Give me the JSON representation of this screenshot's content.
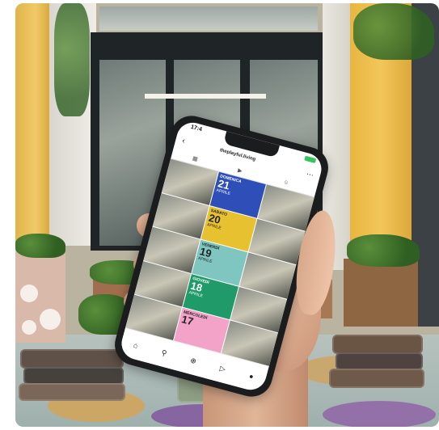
{
  "phone": {
    "status_time": "17:4",
    "username": "theplayful.living",
    "back_icon": "chevron-left-icon",
    "menu_icon": "more-icon",
    "tabs": [
      "grid-icon",
      "reels-icon",
      "tagged-icon"
    ],
    "nav_icons": [
      "home-icon",
      "search-icon",
      "add-icon",
      "reels-icon",
      "profile-icon"
    ],
    "posts": [
      {
        "kind": "photo"
      },
      {
        "kind": "day",
        "name": "DOMENICA",
        "num": "21",
        "mon": "APRILE",
        "color": "#2f4fb8"
      },
      {
        "kind": "photo"
      },
      {
        "kind": "photo"
      },
      {
        "kind": "day",
        "name": "SABATO",
        "num": "20",
        "mon": "APRILE",
        "color": "#e8c131",
        "dark": true
      },
      {
        "kind": "photo"
      },
      {
        "kind": "photo"
      },
      {
        "kind": "day",
        "name": "VENERDÌ",
        "num": "19",
        "mon": "APRILE",
        "color": "#7fc6c0",
        "dark": true
      },
      {
        "kind": "photo"
      },
      {
        "kind": "photo"
      },
      {
        "kind": "day",
        "name": "GIOVEDÌ",
        "num": "18",
        "mon": "APRILE",
        "color": "#1f9a68"
      },
      {
        "kind": "photo"
      },
      {
        "kind": "photo"
      },
      {
        "kind": "day",
        "name": "MERCOLEDÌ",
        "num": "17",
        "mon": "",
        "color": "#f2a3c7",
        "dark": true
      },
      {
        "kind": "photo"
      }
    ]
  }
}
